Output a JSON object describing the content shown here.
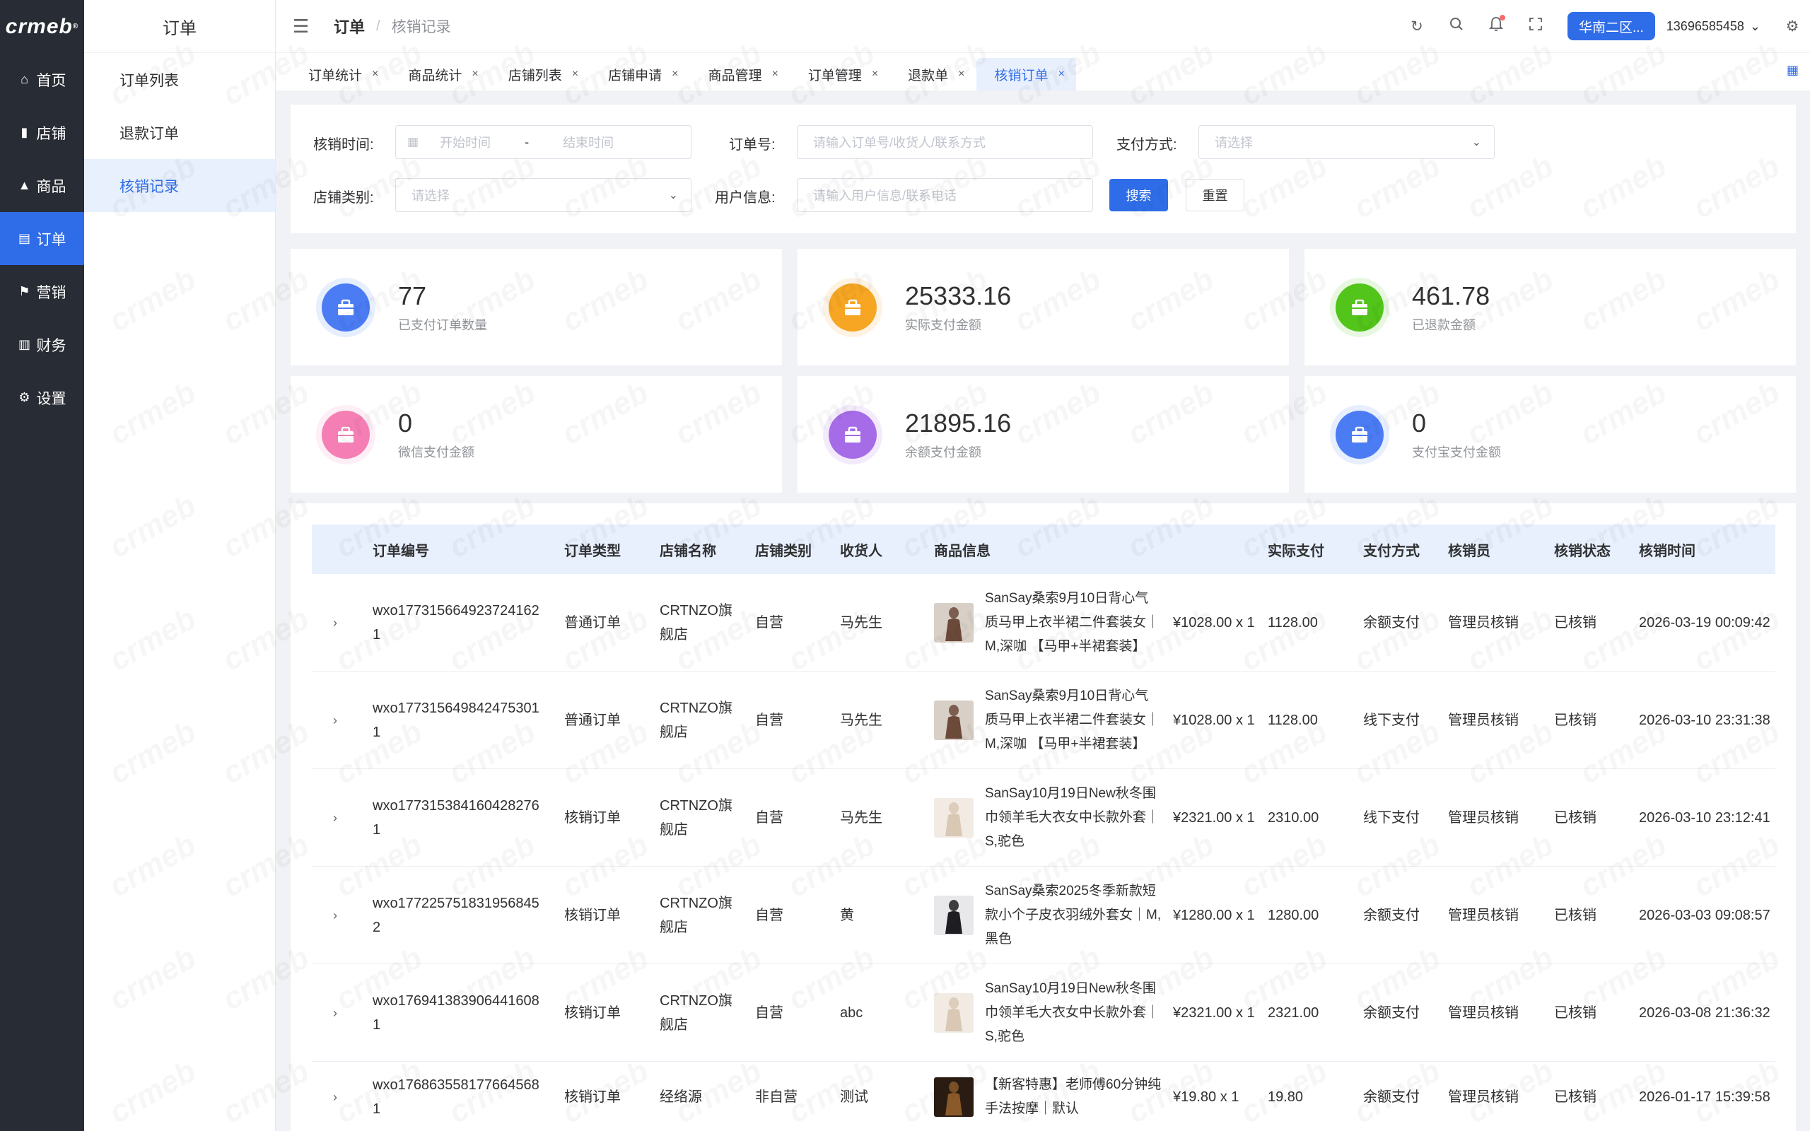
{
  "brand": {
    "logo": "crmeb",
    "logo_mark": "®"
  },
  "sidebar": {
    "items": [
      {
        "label": "首页",
        "icon": "home-icon",
        "glyph": "⌂"
      },
      {
        "label": "店铺",
        "icon": "store-icon",
        "glyph": "▮"
      },
      {
        "label": "商品",
        "icon": "bag-icon",
        "glyph": "▲"
      },
      {
        "label": "订单",
        "icon": "order-icon",
        "glyph": "▤"
      },
      {
        "label": "营销",
        "icon": "flag-icon",
        "glyph": "⚑"
      },
      {
        "label": "财务",
        "icon": "chart-icon",
        "glyph": "▥"
      },
      {
        "label": "设置",
        "icon": "gear-icon",
        "glyph": "⚙"
      }
    ],
    "active_index": 3
  },
  "submenu": {
    "title": "订单",
    "items": [
      "订单列表",
      "退款订单",
      "核销记录"
    ],
    "active_index": 2
  },
  "header": {
    "breadcrumb_main": "订单",
    "breadcrumb_sep": "/",
    "breadcrumb_sub": "核销记录",
    "region": "华南二区...",
    "user": "13696585458",
    "user_chevron": "⌄"
  },
  "tabs": [
    {
      "label": "订单统计",
      "close": "×"
    },
    {
      "label": "商品统计",
      "close": "×"
    },
    {
      "label": "店铺列表",
      "close": "×"
    },
    {
      "label": "店铺申请",
      "close": "×"
    },
    {
      "label": "商品管理",
      "close": "×"
    },
    {
      "label": "订单管理",
      "close": "×"
    },
    {
      "label": "退款单",
      "close": "×"
    },
    {
      "label": "核销订单",
      "close": "×"
    }
  ],
  "filter": {
    "verify_time_label": "核销时间:",
    "start_placeholder": "开始时间",
    "range_sep": "-",
    "end_placeholder": "结束时间",
    "order_no_label": "订单号:",
    "order_no_placeholder": "请输入订单号/收货人/联系方式",
    "pay_method_label": "支付方式:",
    "pay_method_placeholder": "请选择",
    "store_type_label": "店铺类别:",
    "store_type_placeholder": "请选择",
    "user_info_label": "用户信息:",
    "user_info_placeholder": "请输入用户信息/联系电话",
    "search_label": "搜索",
    "reset_label": "重置"
  },
  "stats": [
    {
      "value": "77",
      "label": "已支付订单数量",
      "color": "#4b7cf3",
      "icon": "bag-icon",
      "glyph": "🛍"
    },
    {
      "value": "25333.16",
      "label": "实际支付金额",
      "color": "#f6a623",
      "icon": "clipboard-icon",
      "glyph": "📋"
    },
    {
      "value": "461.78",
      "label": "已退款金额",
      "color": "#52c41a",
      "icon": "briefcase-icon",
      "glyph": "💼"
    },
    {
      "value": "0",
      "label": "微信支付金额",
      "color": "#f57fb4",
      "icon": "briefcase-icon",
      "glyph": "💼"
    },
    {
      "value": "21895.16",
      "label": "余额支付金额",
      "color": "#a66ce8",
      "icon": "wallet-icon",
      "glyph": "👛"
    },
    {
      "value": "0",
      "label": "支付宝支付金额",
      "color": "#4b7cf3",
      "icon": "briefcase-icon",
      "glyph": "💼"
    }
  ],
  "table": {
    "headers": [
      "订单编号",
      "订单类型",
      "店铺名称",
      "店铺类别",
      "收货人",
      "商品信息",
      "实际支付",
      "支付方式",
      "核销员",
      "核销状态",
      "核销时间"
    ],
    "rows": [
      {
        "order_no": "wxo177315664923724162 1",
        "type": "普通订单",
        "store": "CRTNZO旗舰店",
        "store_type": "自营",
        "receiver": "马先生",
        "product": "SanSay桑索9月10日背心气质马甲上衣半裙二件套装女｜M,深咖 【马甲+半裙套装】",
        "price": "¥1028.00 x 1",
        "paid": "1128.00",
        "pay_method": "余额支付",
        "verifier": "管理员核销",
        "status": "已核销",
        "time": "2026-03-19 00:09:42"
      },
      {
        "order_no": "wxo1773156498424753011",
        "type": "普通订单",
        "store": "CRTNZO旗舰店",
        "store_type": "自营",
        "receiver": "马先生",
        "product": "SanSay桑索9月10日背心气质马甲上衣半裙二件套装女｜M,深咖 【马甲+半裙套装】",
        "price": "¥1028.00 x 1",
        "paid": "1128.00",
        "pay_method": "线下支付",
        "verifier": "管理员核销",
        "status": "已核销",
        "time": "2026-03-10 23:31:38"
      },
      {
        "order_no": "wxo177315384160428276 1",
        "type": "核销订单",
        "store": "CRTNZO旗舰店",
        "store_type": "自营",
        "receiver": "马先生",
        "product": "SanSay10月19日New秋冬围巾领羊毛大衣女中长款外套｜S,驼色",
        "price": "¥2321.00 x 1",
        "paid": "2310.00",
        "pay_method": "线下支付",
        "verifier": "管理员核销",
        "status": "已核销",
        "time": "2026-03-10 23:12:41"
      },
      {
        "order_no": "wxo177225751831956845 2",
        "type": "核销订单",
        "store": "CRTNZO旗舰店",
        "store_type": "自营",
        "receiver": "黄",
        "product": "SanSay桑索2025冬季新款短款小个子皮衣羽绒外套女｜M,黑色",
        "price": "¥1280.00 x 1",
        "paid": "1280.00",
        "pay_method": "余额支付",
        "verifier": "管理员核销",
        "status": "已核销",
        "time": "2026-03-03 09:08:57"
      },
      {
        "order_no": "wxo176941383906441608 1",
        "type": "核销订单",
        "store": "CRTNZO旗舰店",
        "store_type": "自营",
        "receiver": "abc",
        "product": "SanSay10月19日New秋冬围巾领羊毛大衣女中长款外套｜S,驼色",
        "price": "¥2321.00 x 1",
        "paid": "2321.00",
        "pay_method": "余额支付",
        "verifier": "管理员核销",
        "status": "已核销",
        "time": "2026-03-08 21:36:32"
      },
      {
        "order_no": "wxo176863558177664568 1",
        "type": "核销订单",
        "store": "经络源",
        "store_type": "非自营",
        "receiver": "测试",
        "product": "【新客特惠】老师傅60分钟纯手法按摩｜默认",
        "price": "¥19.80 x 1",
        "paid": "19.80",
        "pay_method": "余额支付",
        "verifier": "管理员核销",
        "status": "已核销",
        "time": "2026-01-17 15:39:58"
      }
    ]
  },
  "colors": {
    "primary": "#2f6de8",
    "sidebar_bg": "#282c34",
    "table_header_bg": "#e8f0fe"
  }
}
